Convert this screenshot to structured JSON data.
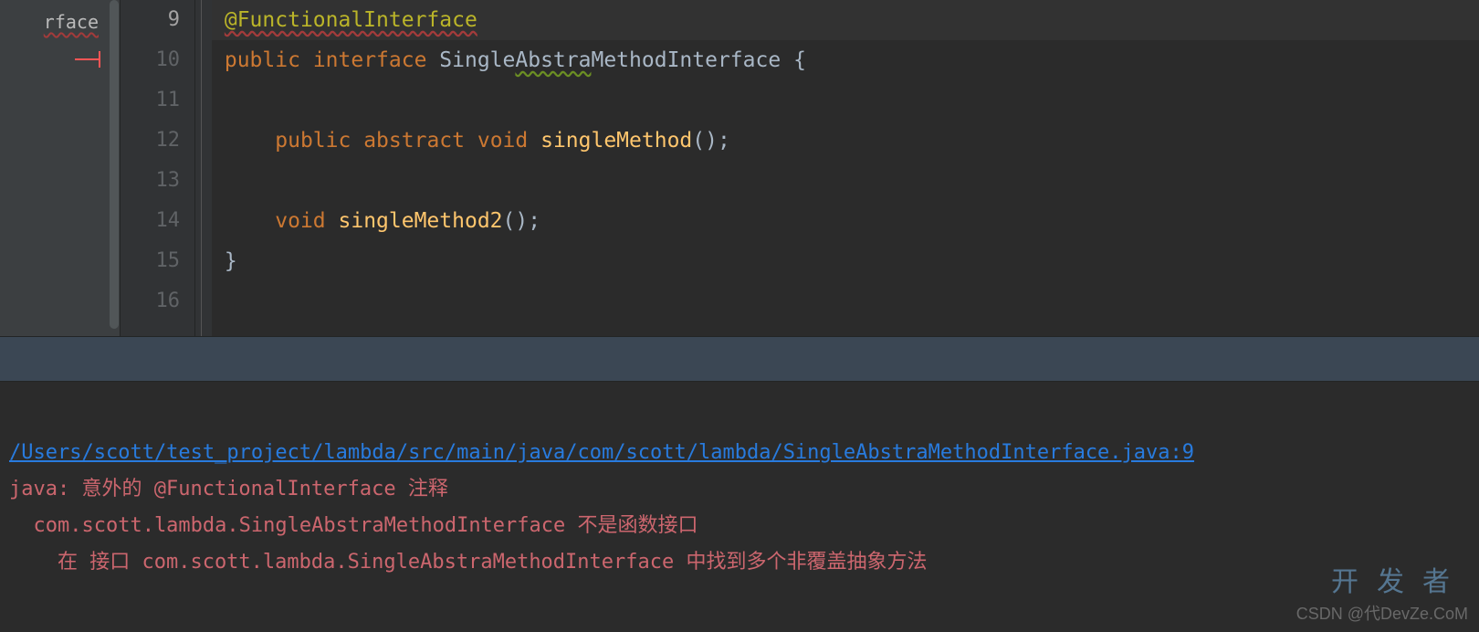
{
  "tab": {
    "label": "rface"
  },
  "gutter": {
    "lines": [
      "9",
      "10",
      "11",
      "12",
      "13",
      "14",
      "15",
      "16"
    ],
    "current": "9"
  },
  "code": {
    "l9": {
      "anno": "@FunctionalInterface"
    },
    "l10": {
      "kw1": "public",
      "kw2": "interface",
      "name": "Single",
      "nameWarn": "Abstra",
      "name2": "MethodInterface",
      "brace": "{"
    },
    "l12": {
      "kw1": "public",
      "kw2": "abstract",
      "kw3": "void",
      "method": "singleMethod",
      "tail": "();"
    },
    "l14": {
      "kw": "void",
      "method": "singleMethod2",
      "tail": "();"
    },
    "l15": {
      "brace": "}"
    }
  },
  "console": {
    "link": "/Users/scott/test_project/lambda/src/main/java/com/scott/lambda/SingleAbstraMethodInterface.java:9",
    "err1": "java: 意外的 @FunctionalInterface 注释",
    "err2": "  com.scott.lambda.SingleAbstraMethodInterface 不是函数接口",
    "err3": "    在 接口 com.scott.lambda.SingleAbstraMethodInterface 中找到多个非覆盖抽象方法"
  },
  "watermark": {
    "main": "开发者",
    "sub": "CSDN @代DevZe.CoM"
  }
}
